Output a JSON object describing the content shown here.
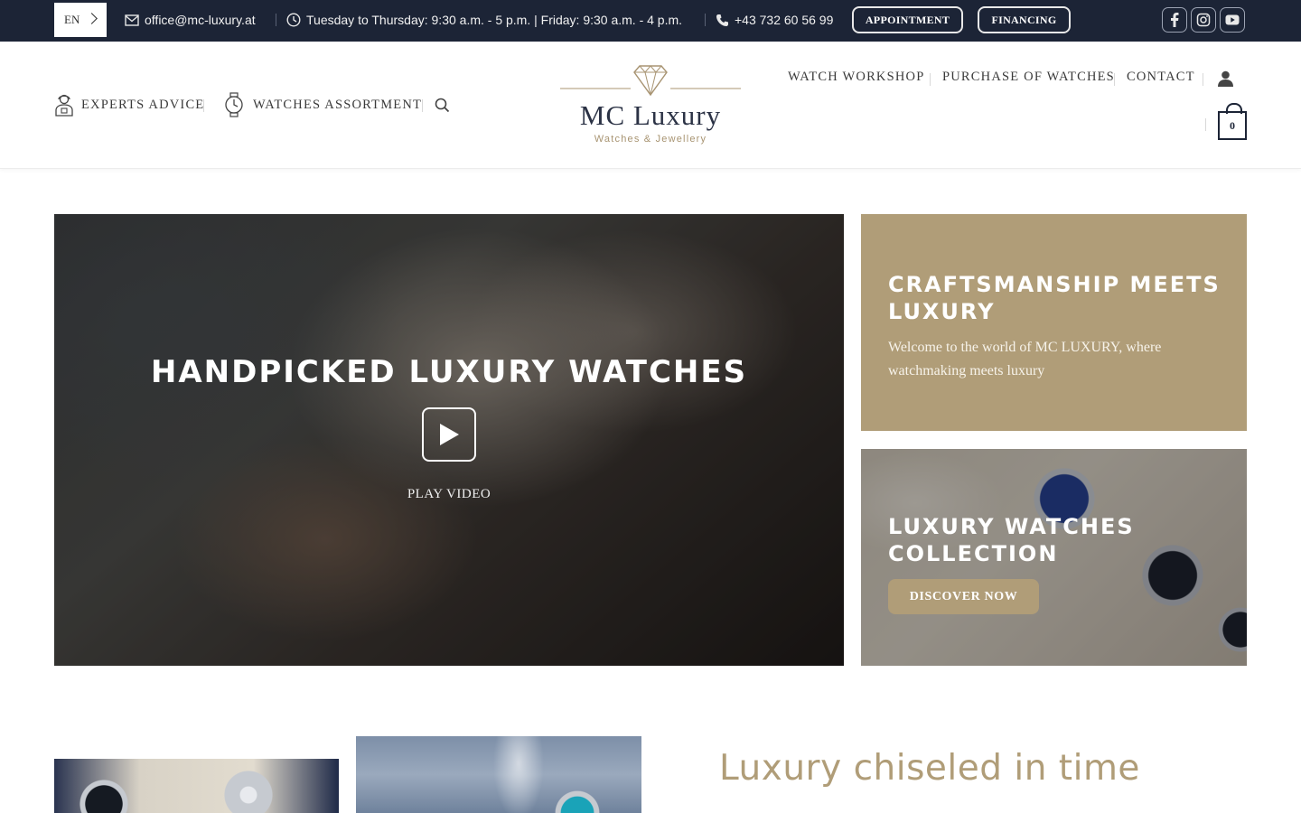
{
  "topbar": {
    "language": "EN",
    "email": "office@mc-luxury.at",
    "hours": "Tuesday to Thursday: 9:30 a.m. - 5 p.m. | Friday: 9:30 a.m. - 4 p.m.",
    "phone": "+43 732 60 56 99",
    "appointment_label": "APPOINTMENT",
    "financing_label": "FINANCING",
    "social": [
      "facebook-icon",
      "instagram-icon",
      "youtube-icon"
    ]
  },
  "header": {
    "nav_left": [
      "EXPERTS ADVICE",
      "WATCHES ASSORTMENT"
    ],
    "logo_title": "MC Luxury",
    "logo_subtitle": "Watches & Jewellery",
    "nav_right": [
      "WATCH WORKSHOP",
      "PURCHASE OF WATCHES",
      "CONTACT"
    ],
    "cart_count": "0"
  },
  "hero": {
    "title": "HANDPICKED LUXURY WATCHES",
    "play_label": "PLAY VIDEO"
  },
  "cards": {
    "card1_title": "CRAFTSMANSHIP MEETS LUXURY",
    "card1_text": "Welcome to the world of MC LUXURY, where watchmaking meets luxury",
    "card2_title": "LUXURY WATCHES COLLECTION",
    "card2_button": "DISCOVER NOW"
  },
  "section": {
    "title": "Luxury chiseled in time"
  },
  "colors": {
    "navy": "#1c2436",
    "gold": "#b09d78"
  }
}
